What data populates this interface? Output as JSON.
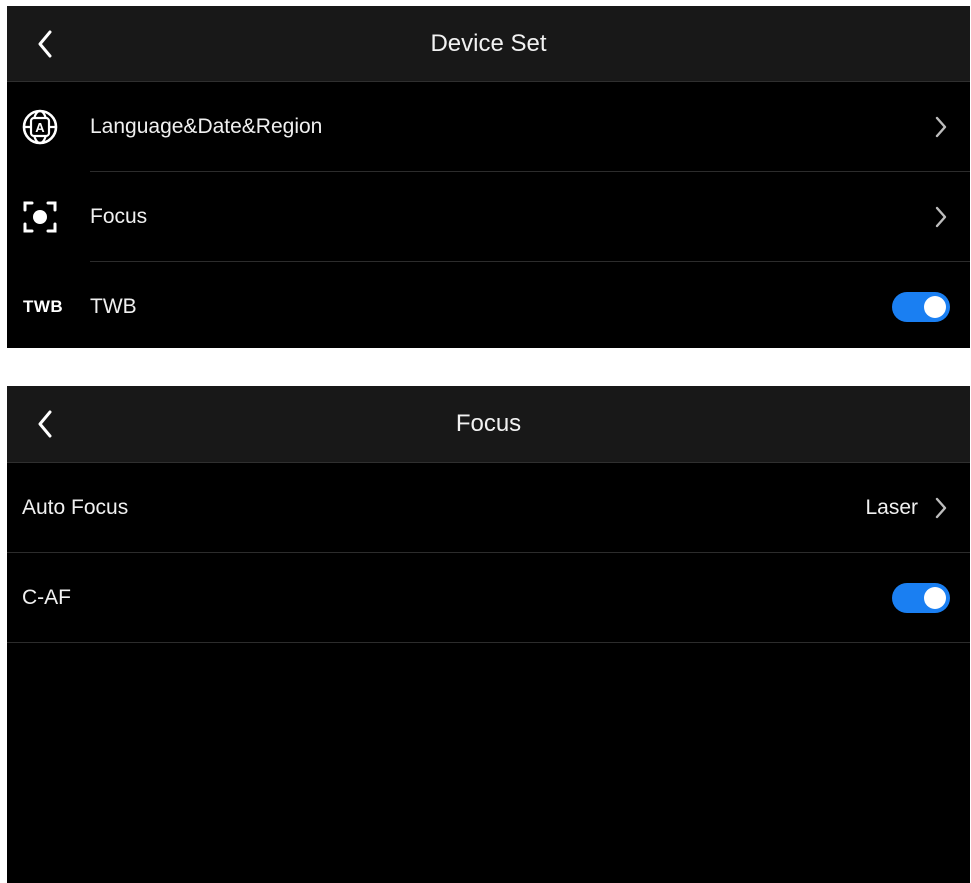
{
  "colors": {
    "background": "#000000",
    "toggle_on": "#1a7ff2",
    "text": "#f0f0f0"
  },
  "device_set": {
    "title": "Device Set",
    "back_icon": "chevron-left-icon",
    "items": [
      {
        "icon": "globe-language-icon",
        "label": "Language&Date&Region",
        "control": "chevron-right-icon"
      },
      {
        "icon": "focus-frame-icon",
        "label": "Focus",
        "control": "chevron-right-icon"
      },
      {
        "icon_text": "TWB",
        "label": "TWB",
        "control": "toggle",
        "toggle_on": true
      }
    ]
  },
  "focus": {
    "title": "Focus",
    "back_icon": "chevron-left-icon",
    "items": [
      {
        "label": "Auto Focus",
        "value": "Laser",
        "control": "chevron-right-icon"
      },
      {
        "label": "C-AF",
        "control": "toggle",
        "toggle_on": true
      }
    ]
  }
}
